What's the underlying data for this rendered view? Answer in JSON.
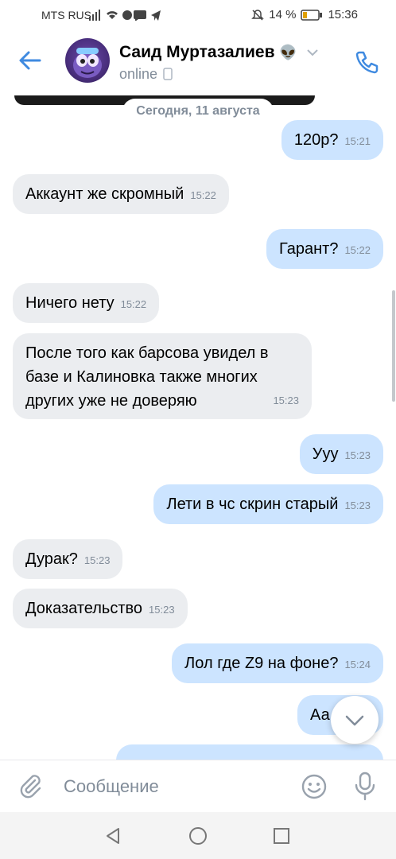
{
  "status_bar": {
    "carrier": "MTS RUS",
    "battery_text": "14 %",
    "time": "15:36"
  },
  "header": {
    "name": "Саид Муртазалиев",
    "emoji": "👽",
    "status": "online"
  },
  "chat": {
    "date_separator": "Сегодня, 11 августа",
    "messages": [
      {
        "dir": "out",
        "text": "120р?",
        "time": "15:21"
      },
      {
        "dir": "in",
        "text": "Аккаунт же скромный",
        "time": "15:22"
      },
      {
        "dir": "out",
        "text": "Гарант?",
        "time": "15:22"
      },
      {
        "dir": "in",
        "text": "Ничего нету",
        "time": "15:22"
      },
      {
        "dir": "in",
        "lines": [
          "После того как барсова увидел в",
          "базе и Калиновка также многих",
          "других уже не доверяю"
        ],
        "time": "15:23"
      },
      {
        "dir": "out",
        "text": "Ууу",
        "time": "15:23"
      },
      {
        "dir": "out",
        "text": "Лети в чс скрин старый",
        "time": "15:23"
      },
      {
        "dir": "in",
        "text": "Дурак?",
        "time": "15:23"
      },
      {
        "dir": "in",
        "text": "Доказательство",
        "time": "15:23"
      },
      {
        "dir": "out",
        "text": "Лол где Z9 на фоне?",
        "time": "15:24"
      },
      {
        "dir": "out",
        "text": "Аа",
        "time": ""
      },
      {
        "dir": "out",
        "text": "",
        "time": ""
      }
    ]
  },
  "composer": {
    "placeholder": "Сообщение"
  },
  "icons": {
    "back": "arrow-left-icon",
    "phone": "phone-icon",
    "attach": "paperclip-icon",
    "emoji": "smile-icon",
    "mic": "microphone-icon",
    "scroll_down": "chevron-down-icon",
    "nav_back": "triangle-back-icon",
    "nav_home": "circle-home-icon",
    "nav_recent": "square-recent-icon"
  },
  "colors": {
    "accent": "#3f8ae0",
    "incoming_bubble": "#ebedf0",
    "outgoing_bubble": "#cce4ff",
    "secondary_text": "#818c99"
  }
}
